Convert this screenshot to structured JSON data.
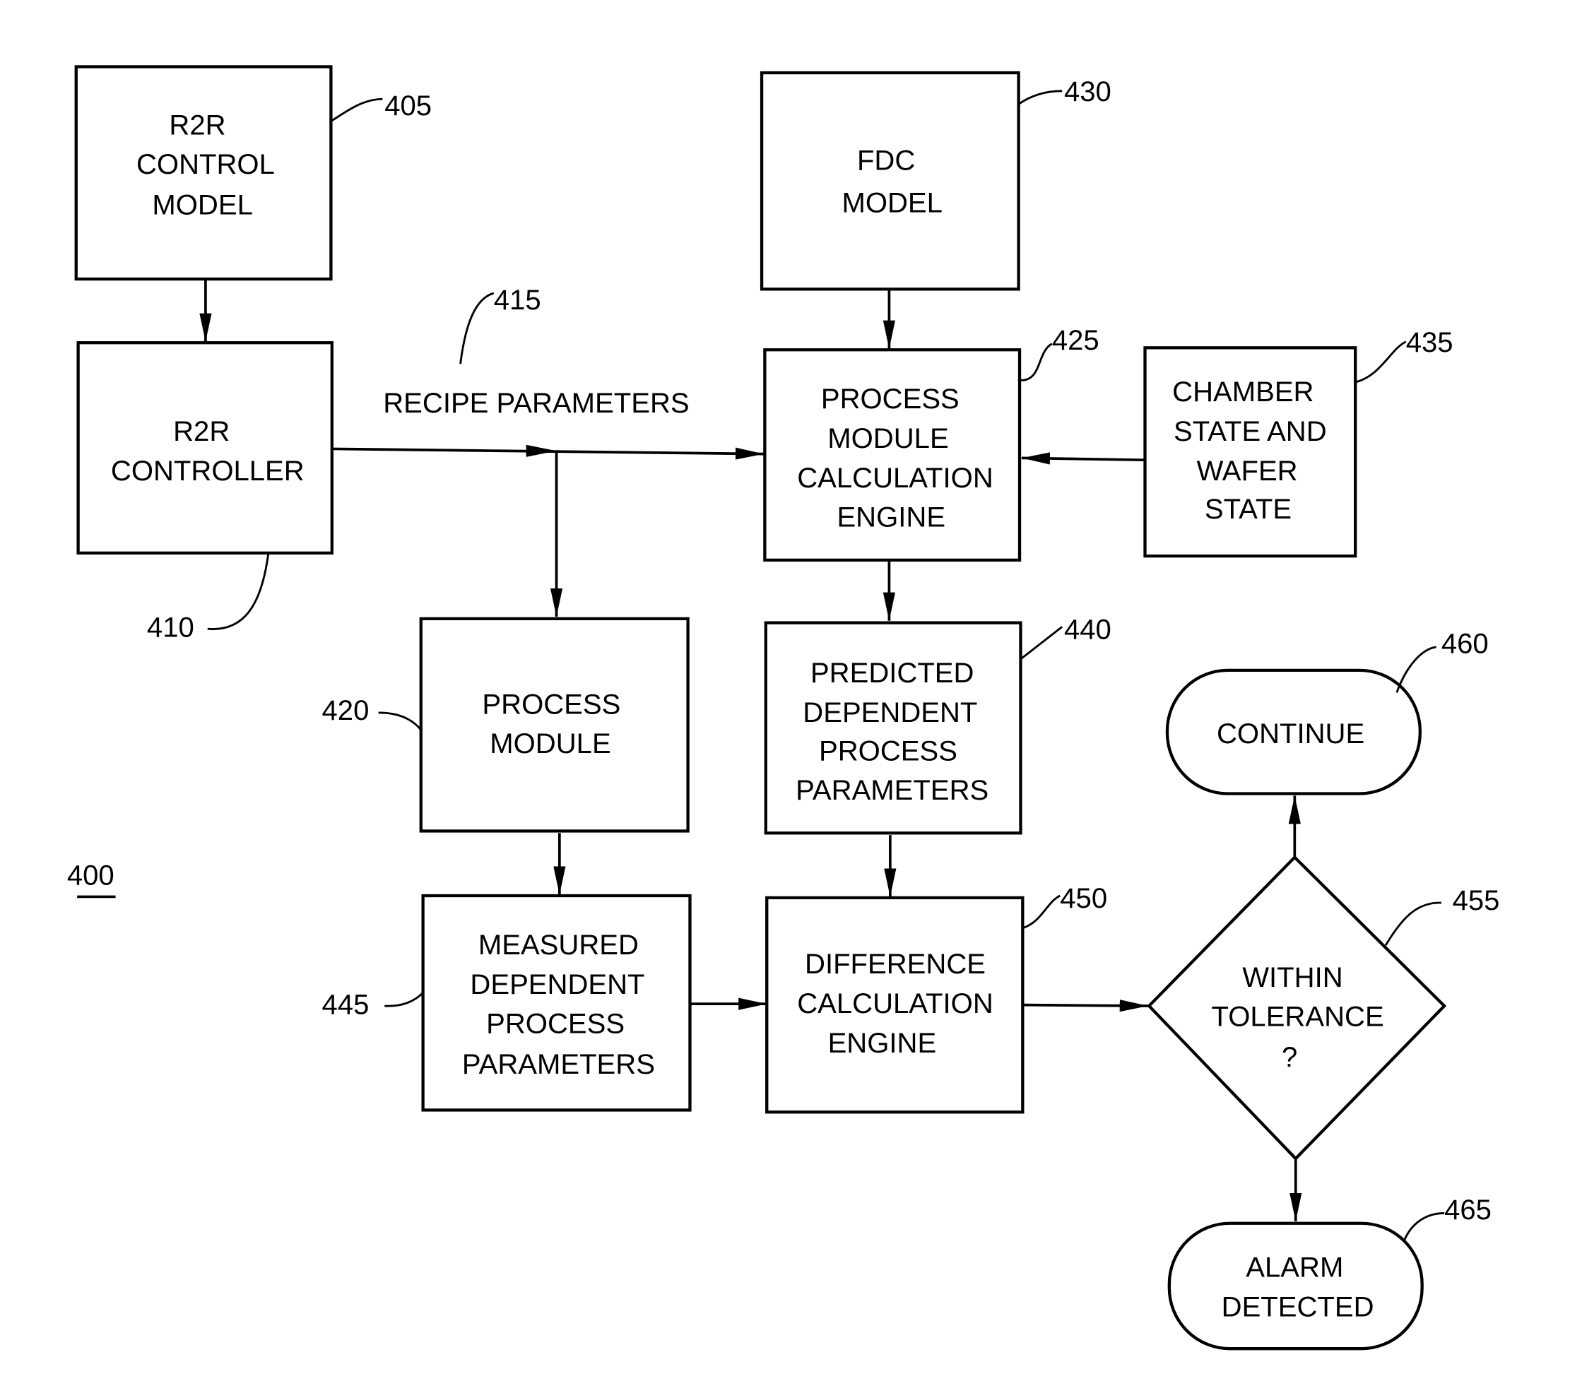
{
  "figure": {
    "figure_ref": "400",
    "nodes": {
      "r2r_control_model": {
        "ref": "405",
        "lines": [
          "R2R",
          "CONTROL",
          "MODEL"
        ]
      },
      "r2r_controller": {
        "ref": "410",
        "lines": [
          "R2R",
          "CONTROLLER"
        ]
      },
      "recipe_parameters": {
        "ref": "415",
        "label": "RECIPE PARAMETERS"
      },
      "process_module": {
        "ref": "420",
        "lines": [
          "PROCESS",
          "MODULE"
        ]
      },
      "process_module_calc_engine": {
        "ref": "425",
        "lines": [
          "PROCESS",
          "MODULE",
          "CALCULATION",
          "ENGINE"
        ]
      },
      "fdc_model": {
        "ref": "430",
        "lines": [
          "FDC",
          "MODEL"
        ]
      },
      "chamber_wafer_state": {
        "ref": "435",
        "lines": [
          "CHAMBER",
          "STATE AND",
          "WAFER",
          "STATE"
        ]
      },
      "predicted_params": {
        "ref": "440",
        "lines": [
          "PREDICTED",
          "DEPENDENT",
          "PROCESS",
          "PARAMETERS"
        ]
      },
      "measured_params": {
        "ref": "445",
        "lines": [
          "MEASURED",
          "DEPENDENT",
          "PROCESS",
          "PARAMETERS"
        ]
      },
      "difference_engine": {
        "ref": "450",
        "lines": [
          "DIFFERENCE",
          "CALCULATION",
          "ENGINE"
        ]
      },
      "within_tolerance": {
        "ref": "455",
        "lines": [
          "WITHIN",
          "TOLERANCE",
          "?"
        ]
      },
      "continue": {
        "ref": "460",
        "lines": [
          "CONTINUE"
        ]
      },
      "alarm_detected": {
        "ref": "465",
        "lines": [
          "ALARM",
          "DETECTED"
        ]
      }
    },
    "edges": [
      [
        "r2r_control_model",
        "r2r_controller"
      ],
      [
        "r2r_controller",
        "process_module_calc_engine"
      ],
      [
        "r2r_controller",
        "process_module"
      ],
      [
        "fdc_model",
        "process_module_calc_engine"
      ],
      [
        "chamber_wafer_state",
        "process_module_calc_engine"
      ],
      [
        "process_module_calc_engine",
        "predicted_params"
      ],
      [
        "process_module",
        "measured_params"
      ],
      [
        "predicted_params",
        "difference_engine"
      ],
      [
        "measured_params",
        "difference_engine"
      ],
      [
        "difference_engine",
        "within_tolerance"
      ],
      [
        "within_tolerance",
        "continue"
      ],
      [
        "within_tolerance",
        "alarm_detected"
      ]
    ]
  }
}
